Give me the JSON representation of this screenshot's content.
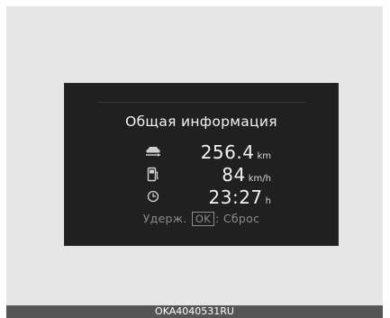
{
  "screen": {
    "title": "Общая информация",
    "rows": [
      {
        "icon": "car-distance-icon",
        "value": "256.4",
        "unit": "km"
      },
      {
        "icon": "fuel-icon",
        "value": "84",
        "unit": "km/h"
      },
      {
        "icon": "clock-icon",
        "value": "23:27",
        "unit": "h"
      }
    ],
    "hint": {
      "prefix": "Удерж.",
      "button": "OK",
      "suffix": ": Сброс"
    }
  },
  "footer": {
    "code": "OKA4040531RU"
  },
  "colors": {
    "background": "#e6e6e6",
    "display": "#202020",
    "footer": "#555555"
  }
}
